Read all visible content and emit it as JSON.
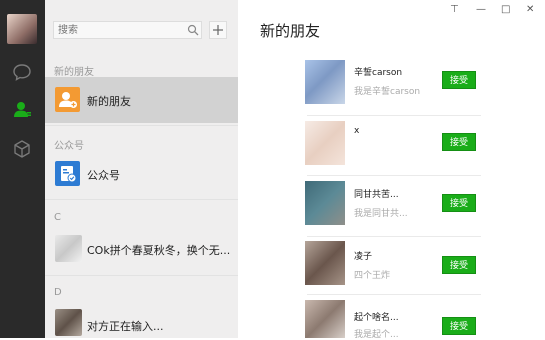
{
  "sidebar_nav": {
    "items": [
      {
        "icon": "chat-icon"
      },
      {
        "icon": "contacts-icon"
      },
      {
        "icon": "favorites-cube-icon"
      }
    ]
  },
  "contacts_panel": {
    "search": {
      "placeholder": "搜索"
    },
    "sections": {
      "new_friends": "新的朋友",
      "official_accounts": "公众号",
      "c": "C",
      "d": "D"
    },
    "items": {
      "new_friends": "新的朋友",
      "official_accounts": "公众号",
      "c_contact": "COk拼个春夏秋冬，换个无...",
      "d_contact": "对方正在输入..."
    }
  },
  "main": {
    "title": "新的朋友",
    "window_controls": {
      "pin": "⊤",
      "minimize": "—",
      "maximize": "□",
      "close": "✕"
    },
    "requests": [
      {
        "name": "辛誓carson",
        "message": "我是辛誓carson",
        "button": "接受"
      },
      {
        "name": "x",
        "message": "",
        "button": "接受"
      },
      {
        "name": "同甘共苦...",
        "message": "我是同甘共...",
        "button": "接受"
      },
      {
        "name": "凌子",
        "message": "四个王炸",
        "button": "接受"
      },
      {
        "name": "起个啥名...",
        "message": "我是起个...",
        "button": "接受"
      }
    ]
  },
  "colors": {
    "accept_green": "#1aad19",
    "nav_bg": "#2a2a2a",
    "list_bg": "#efeeee",
    "selected_bg": "#d2d2d2",
    "contacts_active": "#1aad19"
  }
}
